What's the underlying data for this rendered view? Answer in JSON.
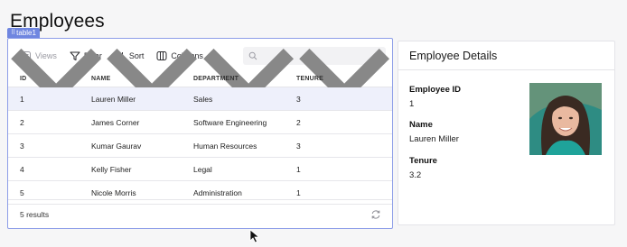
{
  "page": {
    "title": "Employees"
  },
  "widget": {
    "tag": "table1"
  },
  "toolbar": {
    "views_label": "Views",
    "filter_label": "Filter",
    "sort_label": "Sort",
    "columns_label": "Columns",
    "search_placeholder": ""
  },
  "table": {
    "columns": [
      "ID",
      "NAME",
      "DEPARTMENT",
      "TENURE"
    ],
    "rows": [
      {
        "id": "1",
        "name": "Lauren Miller",
        "department": "Sales",
        "tenure": "3"
      },
      {
        "id": "2",
        "name": "James Corner",
        "department": "Software Engineering",
        "tenure": "2"
      },
      {
        "id": "3",
        "name": "Kumar Gaurav",
        "department": "Human Resources",
        "tenure": "3"
      },
      {
        "id": "4",
        "name": "Kelly Fisher",
        "department": "Legal",
        "tenure": "1"
      },
      {
        "id": "5",
        "name": "Nicole Morris",
        "department": "Administration",
        "tenure": "1"
      }
    ],
    "selected_row": 0,
    "footer": "5 results"
  },
  "details": {
    "title": "Employee Details",
    "fields": [
      {
        "label": "Employee ID",
        "value": "1"
      },
      {
        "label": "Name",
        "value": "Lauren Miller"
      },
      {
        "label": "Tenure",
        "value": "3.2"
      }
    ],
    "photo_icon": "employee-photo"
  },
  "colors": {
    "accent": "#6f86e0",
    "selected_row": "#eef0fb",
    "border": "#e4e4e8"
  }
}
